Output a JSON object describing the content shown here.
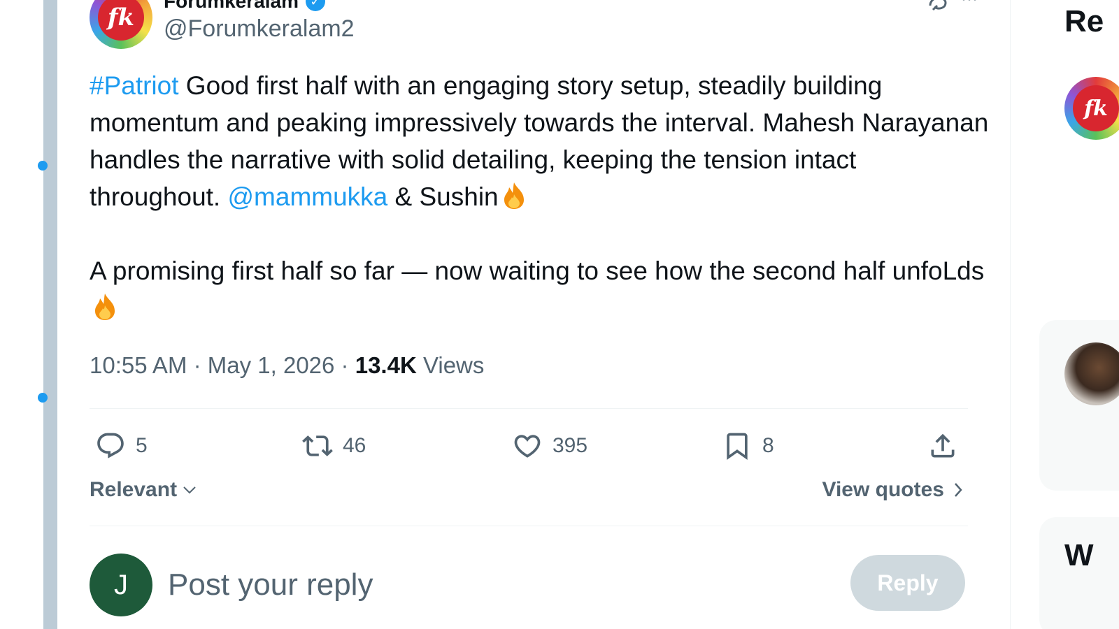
{
  "post": {
    "author": {
      "display_name": "Forumkeralam",
      "handle": "@Forumkeralam2",
      "avatar_text": "fk",
      "verified": true
    },
    "text": {
      "hashtag": "#Patriot",
      "part1": " Good first half with an engaging story setup, steadily building momentum and peaking impressively towards the interval. Mahesh Narayanan handles the narrative with solid detailing, keeping the tension intact throughout. ",
      "mention": "@mammukka",
      "part2": " & Sushin",
      "paragraph2": "A promising first half so far — now waiting to see how the second half unfoLds"
    },
    "meta": {
      "time": "10:55 AM",
      "separator": " · ",
      "date": "May 1, 2026",
      "views_count": "13.4K",
      "views_label": " Views"
    },
    "actions": {
      "replies": "5",
      "reposts": "46",
      "likes": "395",
      "bookmarks": "8"
    }
  },
  "sort": {
    "label": "Relevant",
    "view_quotes": "View quotes"
  },
  "reply_box": {
    "avatar_letter": "J",
    "placeholder": "Post your reply",
    "button_label": "Reply"
  },
  "sidebar": {
    "title1": "Re",
    "title2": "W",
    "avatar_text": "fk"
  },
  "colors": {
    "accent": "#1d9bf0",
    "text": "#0f1419",
    "secondary": "#536471",
    "reply_button": "#cfd9de",
    "reply_avatar": "#1e5a3a"
  }
}
